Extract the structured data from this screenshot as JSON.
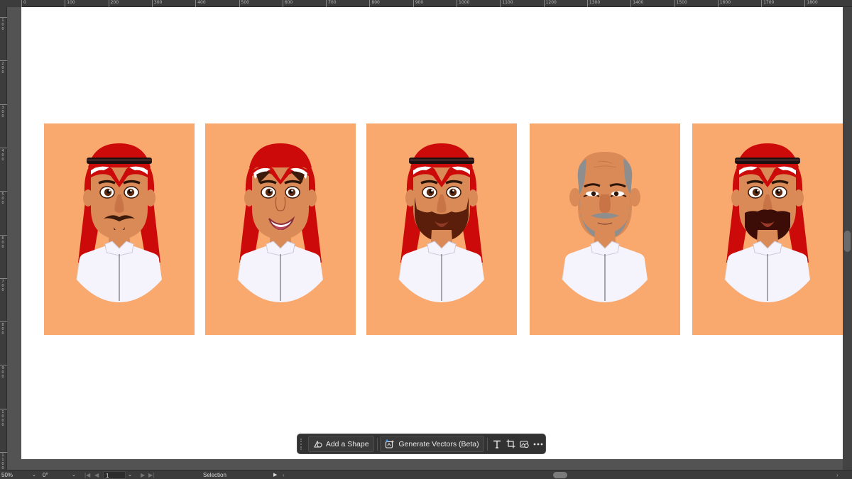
{
  "rulers": {
    "top_labels": [
      "0",
      "100",
      "200",
      "300",
      "400",
      "500",
      "600",
      "700",
      "800",
      "900",
      "1000",
      "1100",
      "1200",
      "1300",
      "1400",
      "1500",
      "1600",
      "1700",
      "1800"
    ],
    "left_labels": [
      "100",
      "200",
      "300",
      "400",
      "500",
      "600",
      "700",
      "800",
      "900",
      "1000",
      "1100"
    ]
  },
  "artboard": {
    "portraits": [
      {
        "name": "saudi-man-mustache-goatee",
        "background": "#f9a86e",
        "headwear": "red ghutra with agal",
        "expression": "neutral"
      },
      {
        "name": "saudi-man-smiling",
        "background": "#f9a86e",
        "headwear": "red ghutra",
        "expression": "smiling"
      },
      {
        "name": "saudi-man-full-beard",
        "background": "#f9a86e",
        "headwear": "red ghutra with agal",
        "expression": "neutral"
      },
      {
        "name": "bald-man-gray-beard",
        "background": "#f9a86e",
        "headwear": "none",
        "expression": "neutral"
      },
      {
        "name": "saudi-man-black-beard",
        "background": "#f9a86e",
        "headwear": "red ghutra with agal",
        "expression": "neutral"
      }
    ]
  },
  "taskbar": {
    "add_shape_label": "Add a Shape",
    "generate_vectors_label": "Generate Vectors (Beta)",
    "icons": [
      "shape-icon",
      "generate-vectors-icon",
      "type-icon",
      "crop-icon",
      "recolor-icon",
      "more-icon"
    ]
  },
  "statusbar": {
    "zoom": "50%",
    "rotation": "0°",
    "artboard_number": "1",
    "tool": "Selection"
  },
  "colors": {
    "skin": "#d98a57",
    "ghutra_red": "#cc0a0a",
    "thobe_white": "#f5f3fb",
    "beard_dark": "#5a1e0a",
    "beard_gray": "#8e8e8e"
  }
}
